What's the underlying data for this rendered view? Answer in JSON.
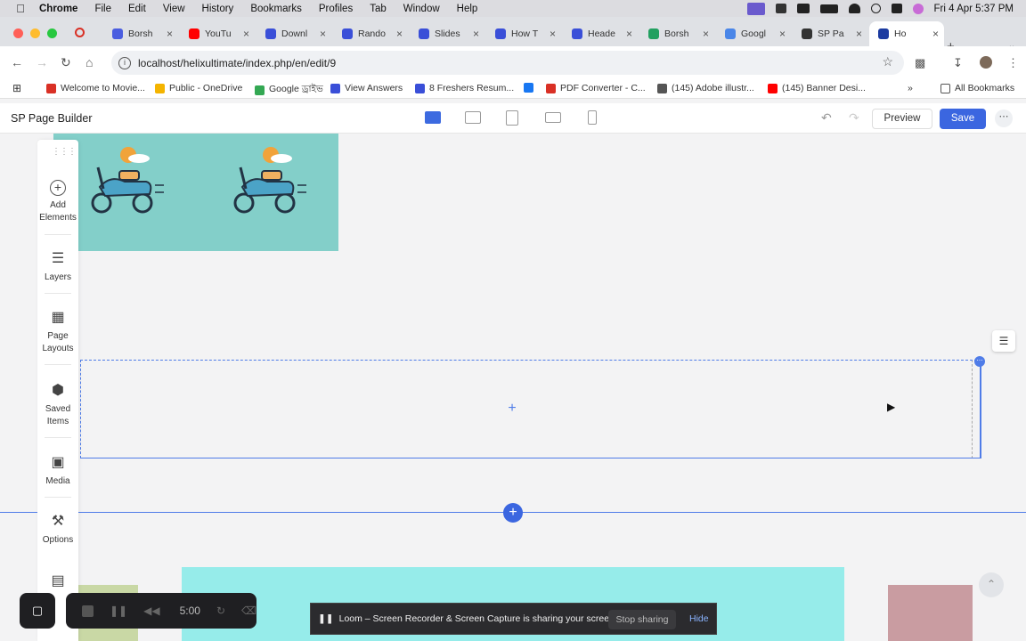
{
  "menubar": {
    "app": "Chrome",
    "items": [
      "File",
      "Edit",
      "View",
      "History",
      "Bookmarks",
      "Profiles",
      "Tab",
      "Window",
      "Help"
    ],
    "datetime": "Fri 4 Apr  5:37 PM"
  },
  "tabs": [
    {
      "label": "Borsh",
      "color": "#4a5de0"
    },
    {
      "label": "YouTu",
      "color": "#ff0000"
    },
    {
      "label": "Downl",
      "color": "#3a4fd8"
    },
    {
      "label": "Rando",
      "color": "#3a4fd8"
    },
    {
      "label": "Slides",
      "color": "#3a4fd8"
    },
    {
      "label": "How T",
      "color": "#3a4fd8"
    },
    {
      "label": "Heade",
      "color": "#3a4fd8"
    },
    {
      "label": "Borsh",
      "color": "#22a060"
    },
    {
      "label": "Googl",
      "color": "#4a86e8"
    },
    {
      "label": "SP Pa",
      "color": "#333333"
    },
    {
      "label": "Ho",
      "color": "#1b3aa0"
    }
  ],
  "address": {
    "url": "localhost/helixultimate/index.php/en/edit/9"
  },
  "bookmarks": [
    {
      "label": "Welcome to Movie...",
      "color": "#d93025"
    },
    {
      "label": "Public - OneDrive",
      "color": "#f4b400"
    },
    {
      "label": "Google ড্রাইভ",
      "color": "#34a853"
    },
    {
      "label": "View Answers",
      "color": "#3a4fd8"
    },
    {
      "label": "8 Freshers Resum...",
      "color": "#3a4fd8"
    },
    {
      "label": "",
      "color": "#1877f2"
    },
    {
      "label": "PDF Converter - C...",
      "color": "#d93025"
    },
    {
      "label": "(145) Adobe illustr...",
      "color": "#555555"
    },
    {
      "label": "(145) Banner Desi...",
      "color": "#ff0000"
    }
  ],
  "bookmarks_all": "All Bookmarks",
  "builder": {
    "title": "SP Page Builder",
    "preview": "Preview",
    "save": "Save",
    "accent": "#3b66e0"
  },
  "sidebar": {
    "items": [
      {
        "label": "Add Elements",
        "icon": "plus-circle-icon"
      },
      {
        "label": "Layers",
        "icon": "layers-icon"
      },
      {
        "label": "Page Layouts",
        "icon": "page-layout-icon"
      },
      {
        "label": "Saved Items",
        "icon": "saved-items-icon"
      },
      {
        "label": "Media",
        "icon": "media-icon"
      },
      {
        "label": "Options",
        "icon": "tools-icon"
      }
    ]
  },
  "loom": {
    "timer": "5:00",
    "share_text": "Loom – Screen Recorder & Screen Capture is sharing your screen.",
    "stop": "Stop sharing",
    "hide": "Hide"
  }
}
